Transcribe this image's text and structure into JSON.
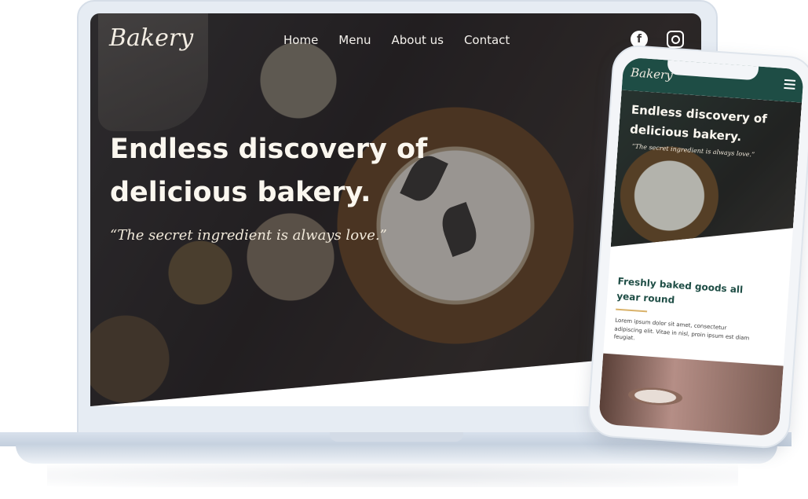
{
  "desktop": {
    "logo": "Bakery",
    "nav": [
      "Home",
      "Menu",
      "About us",
      "Contact"
    ],
    "social": [
      {
        "icon": "facebook-icon",
        "glyph": "f"
      },
      {
        "icon": "instagram-icon",
        "glyph": ""
      }
    ],
    "headline": "Endless discovery of delicious bakery.",
    "tagline": "“The secret ingredient is always love.”"
  },
  "mobile": {
    "logo": "Bakery",
    "menu_icon": "hamburger-menu-icon",
    "headline": "Endless discovery of delicious bakery.",
    "tagline": "“The secret ingredient is always love.”",
    "section_title": "Freshly baked goods all year round",
    "body": "Lorem ipsum dolor sit amet, consectetur adipiscing elit. Vitae in nisl, proin ipsum est diam feugiat."
  },
  "colors": {
    "brand_green": "#1e4d45",
    "accent_gold": "#d9b26a",
    "device_frame": "#e6ecf3"
  }
}
